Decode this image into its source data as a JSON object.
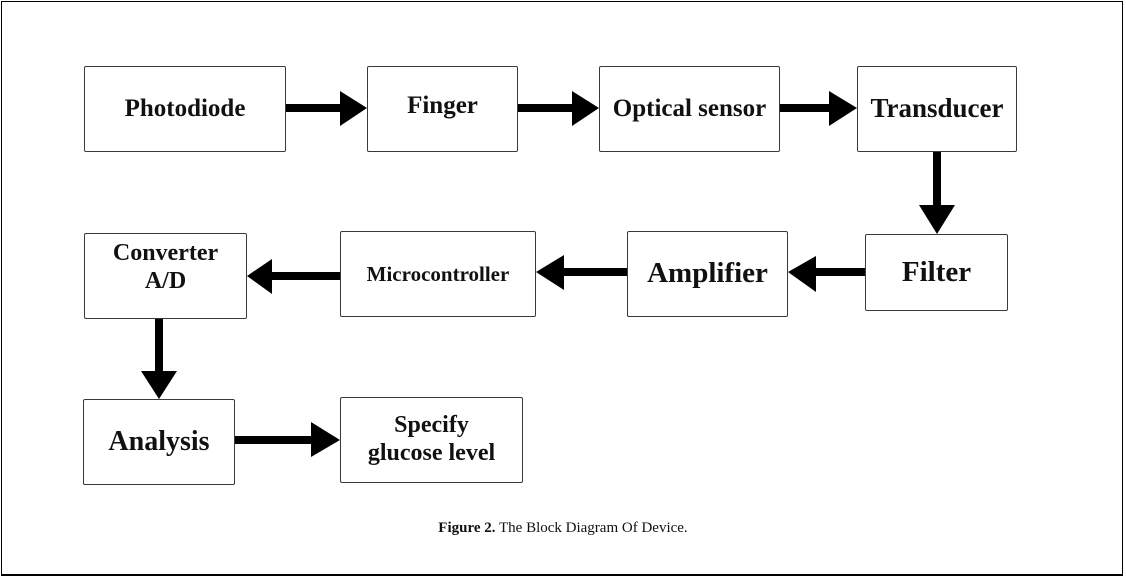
{
  "diagram": {
    "blocks": {
      "photodiode": {
        "label": "Photodiode"
      },
      "finger": {
        "label": "Finger"
      },
      "optical_sensor": {
        "label": "Optical sensor"
      },
      "transducer": {
        "label": "Transducer"
      },
      "filter": {
        "label": "Filter"
      },
      "amplifier": {
        "label": "Amplifier"
      },
      "microcontroller": {
        "label": "Microcontroller"
      },
      "converter": {
        "line1": "Converter",
        "line2": "A/D"
      },
      "analysis": {
        "label": "Analysis"
      },
      "specify": {
        "line1": "Specify",
        "line2": "glucose level"
      }
    },
    "flow": [
      [
        "Photodiode",
        "Finger"
      ],
      [
        "Finger",
        "Optical sensor"
      ],
      [
        "Optical sensor",
        "Transducer"
      ],
      [
        "Transducer",
        "Filter"
      ],
      [
        "Filter",
        "Amplifier"
      ],
      [
        "Amplifier",
        "Microcontroller"
      ],
      [
        "Microcontroller",
        "Converter A/D"
      ],
      [
        "Converter A/D",
        "Analysis"
      ],
      [
        "Analysis",
        "Specify glucose level"
      ]
    ]
  },
  "caption": {
    "label": "Figure 2.",
    "text": " The Block Diagram Of Device."
  }
}
